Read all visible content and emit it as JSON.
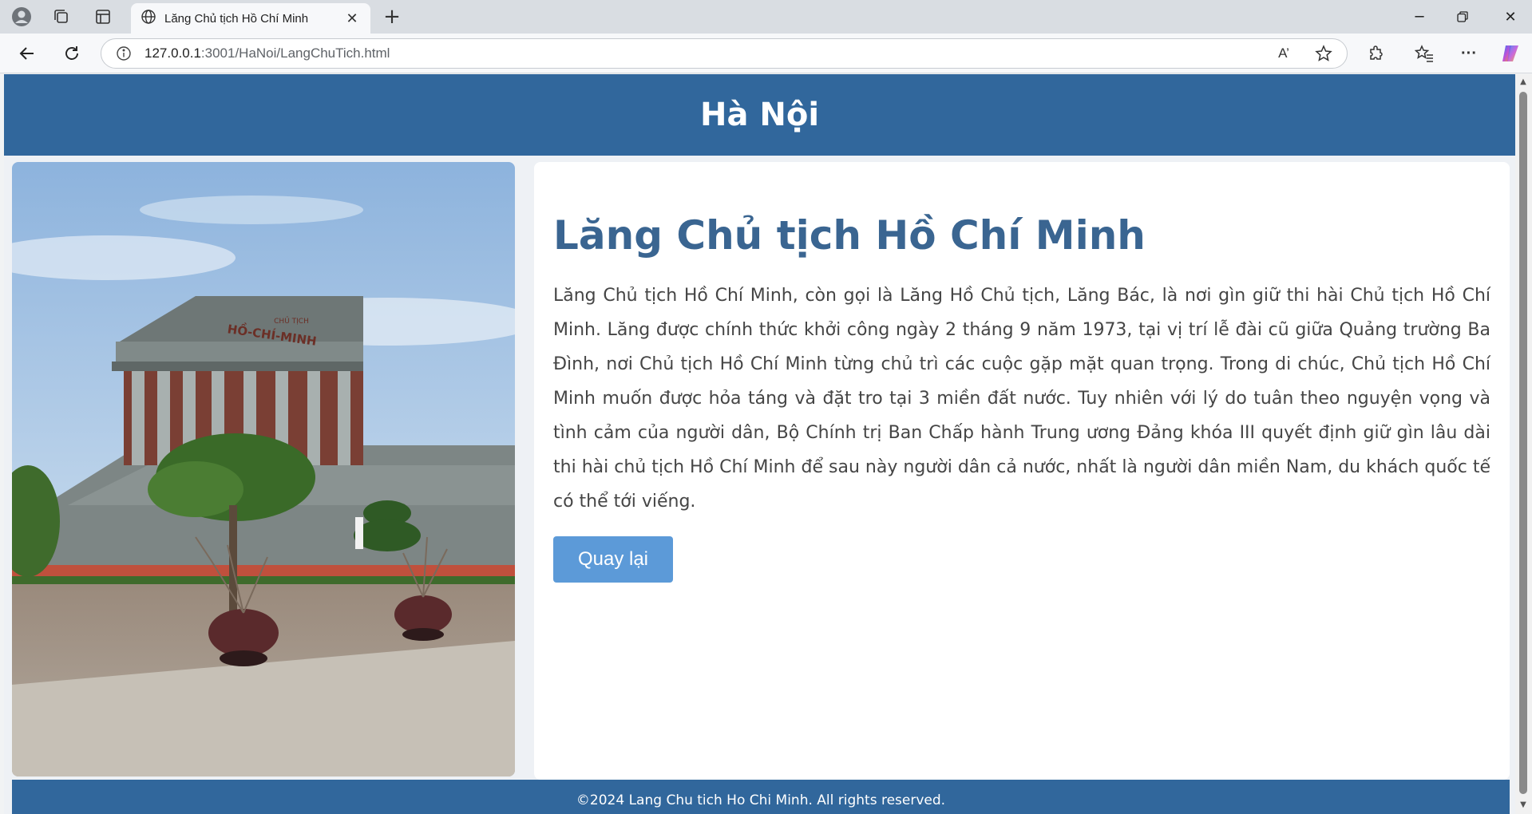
{
  "browser": {
    "tab_title": "Lăng Chủ tịch Hồ Chí Minh",
    "url_host": "127.0.0.1",
    "url_path": ":3001/HaNoi/LangChuTich.html",
    "read_aloud_glyph": "A’",
    "icons": [
      "profile-icon",
      "workspaces-icon",
      "tab-actions-icon",
      "globe-icon",
      "close-icon",
      "new-tab-icon",
      "minimize-icon",
      "restore-icon",
      "window-close-icon",
      "back-icon",
      "reload-icon",
      "info-icon",
      "read-aloud-icon",
      "favorite-star-icon",
      "extensions-icon",
      "favorites-icon",
      "more-icon",
      "copilot-icon"
    ]
  },
  "header": {
    "title": "Hà Nội"
  },
  "main": {
    "title": "Lăng Chủ tịch Hồ Chí Minh",
    "description": "Lăng Chủ tịch Hồ Chí Minh, còn gọi là Lăng Hồ Chủ tịch, Lăng Bác, là nơi gìn giữ thi hài Chủ tịch Hồ Chí Minh. Lăng được chính thức khởi công ngày 2 tháng 9 năm 1973, tại vị trí lễ đài cũ giữa Quảng trường Ba Đình, nơi Chủ tịch Hồ Chí Minh từng chủ trì các cuộc gặp mặt quan trọng. Trong di chúc, Chủ tịch Hồ Chí Minh muốn được hỏa táng và đặt tro tại 3 miền đất nước. Tuy nhiên với lý do tuân theo nguyện vọng và tình cảm của người dân, Bộ Chính trị Ban Chấp hành Trung ương Đảng khóa III quyết định giữ gìn lâu dài thi hài chủ tịch Hồ Chí Minh để sau này người dân cả nước, nhất là người dân miền Nam, du khách quốc tế có thể tới viếng.",
    "back_button": "Quay lại",
    "photo_sign_top": "CHỦ TỊCH",
    "photo_sign_main": "HỒ-CHÍ-MINH"
  },
  "footer": {
    "text": "©2024 Lang Chu tich Ho Chi Minh. All rights reserved."
  },
  "colors": {
    "header_bg": "#31679c",
    "title": "#3a6591",
    "button": "#5c9ad8"
  }
}
